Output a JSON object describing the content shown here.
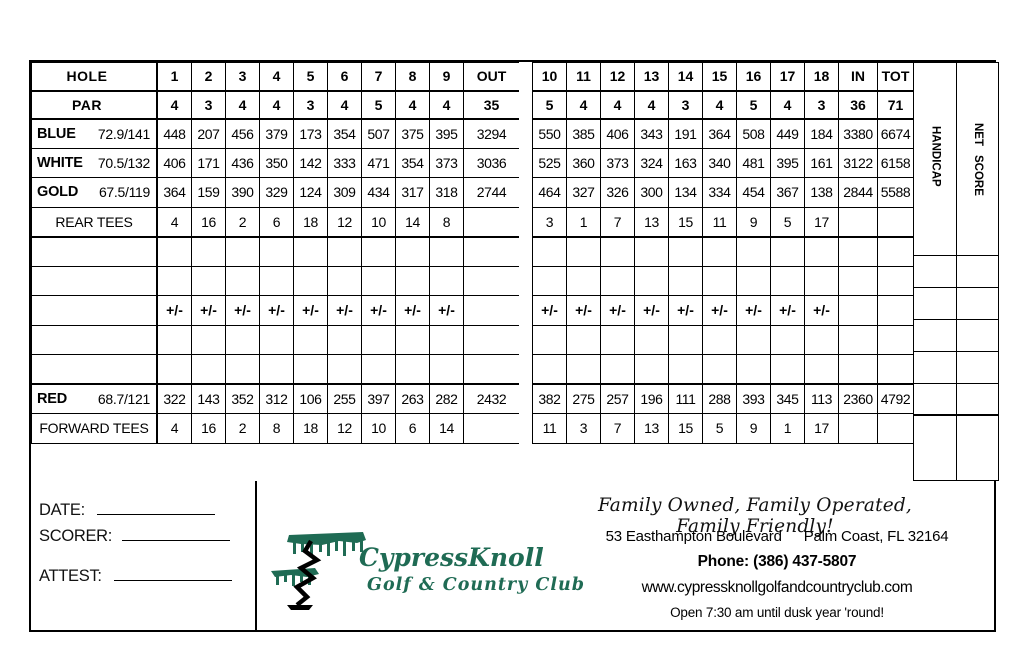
{
  "scorecard": {
    "row_labels": {
      "hole": "HOLE",
      "par": "PAR",
      "rear_tees": "REAR TEES",
      "forward_tees": "FORWARD TEES"
    },
    "tees": [
      {
        "name": "BLUE",
        "rating": "72.9/141"
      },
      {
        "name": "WHITE",
        "rating": "70.5/132"
      },
      {
        "name": "GOLD",
        "rating": "67.5/119"
      },
      {
        "name": "RED",
        "rating": "68.7/121"
      }
    ],
    "front": {
      "holes": [
        "1",
        "2",
        "3",
        "4",
        "5",
        "6",
        "7",
        "8",
        "9"
      ],
      "out_label": "OUT",
      "par": [
        "4",
        "3",
        "4",
        "4",
        "3",
        "4",
        "5",
        "4",
        "4"
      ],
      "par_out": "35",
      "blue": [
        "448",
        "207",
        "456",
        "379",
        "173",
        "354",
        "507",
        "375",
        "395"
      ],
      "blue_out": "3294",
      "white": [
        "406",
        "171",
        "436",
        "350",
        "142",
        "333",
        "471",
        "354",
        "373"
      ],
      "white_out": "3036",
      "gold": [
        "364",
        "159",
        "390",
        "329",
        "124",
        "309",
        "434",
        "317",
        "318"
      ],
      "gold_out": "2744",
      "rear_handicap": [
        "4",
        "16",
        "2",
        "6",
        "18",
        "12",
        "10",
        "14",
        "8"
      ],
      "rear_handicap_out": "",
      "red": [
        "322",
        "143",
        "352",
        "312",
        "106",
        "255",
        "397",
        "263",
        "282"
      ],
      "red_out": "2432",
      "forward_handicap": [
        "4",
        "16",
        "2",
        "8",
        "18",
        "12",
        "10",
        "6",
        "14"
      ],
      "forward_handicap_out": "",
      "plus_minus": [
        "+/-",
        "+/-",
        "+/-",
        "+/-",
        "+/-",
        "+/-",
        "+/-",
        "+/-",
        "+/-"
      ],
      "plus_minus_out": ""
    },
    "back": {
      "holes": [
        "10",
        "11",
        "12",
        "13",
        "14",
        "15",
        "16",
        "17",
        "18"
      ],
      "in_label": "IN",
      "tot_label": "TOT",
      "par": [
        "5",
        "4",
        "4",
        "4",
        "3",
        "4",
        "5",
        "4",
        "3"
      ],
      "par_in": "36",
      "par_tot": "71",
      "blue": [
        "550",
        "385",
        "406",
        "343",
        "191",
        "364",
        "508",
        "449",
        "184"
      ],
      "blue_in": "3380",
      "blue_tot": "6674",
      "white": [
        "525",
        "360",
        "373",
        "324",
        "163",
        "340",
        "481",
        "395",
        "161"
      ],
      "white_in": "3122",
      "white_tot": "6158",
      "gold": [
        "464",
        "327",
        "326",
        "300",
        "134",
        "334",
        "454",
        "367",
        "138"
      ],
      "gold_in": "2844",
      "gold_tot": "5588",
      "rear_handicap": [
        "3",
        "1",
        "7",
        "13",
        "15",
        "11",
        "9",
        "5",
        "17"
      ],
      "rear_handicap_in": "",
      "rear_handicap_tot": "",
      "red": [
        "382",
        "275",
        "257",
        "196",
        "111",
        "288",
        "393",
        "345",
        "113"
      ],
      "red_in": "2360",
      "red_tot": "4792",
      "forward_handicap": [
        "11",
        "3",
        "7",
        "13",
        "15",
        "5",
        "9",
        "1",
        "17"
      ],
      "forward_handicap_in": "",
      "forward_handicap_tot": "",
      "plus_minus": [
        "+/-",
        "+/-",
        "+/-",
        "+/-",
        "+/-",
        "+/-",
        "+/-",
        "+/-",
        "+/-"
      ],
      "plus_minus_in": "",
      "plus_minus_tot": ""
    },
    "side_columns": {
      "handicap": "HANDICAP",
      "net": "NET",
      "score": "SCORE"
    }
  },
  "footer": {
    "date_label": "DATE:",
    "scorer_label": "SCORER:",
    "attest_label": "ATTEST:",
    "slogan": "Family Owned, Family Operated, Family Friendly!",
    "address": "53 Easthampton Boulevard",
    "city_state_zip": "Palm Coast, FL  32164",
    "phone": "Phone: (386) 437-5807",
    "website": "www.cypressknollgolfandcountryclub.com",
    "hours": "Open 7:30 am until dusk year 'round!",
    "logo_name": "CypressKnoll",
    "logo_sub": "Golf & Country Club",
    "logo_color": "#1f6b54"
  }
}
